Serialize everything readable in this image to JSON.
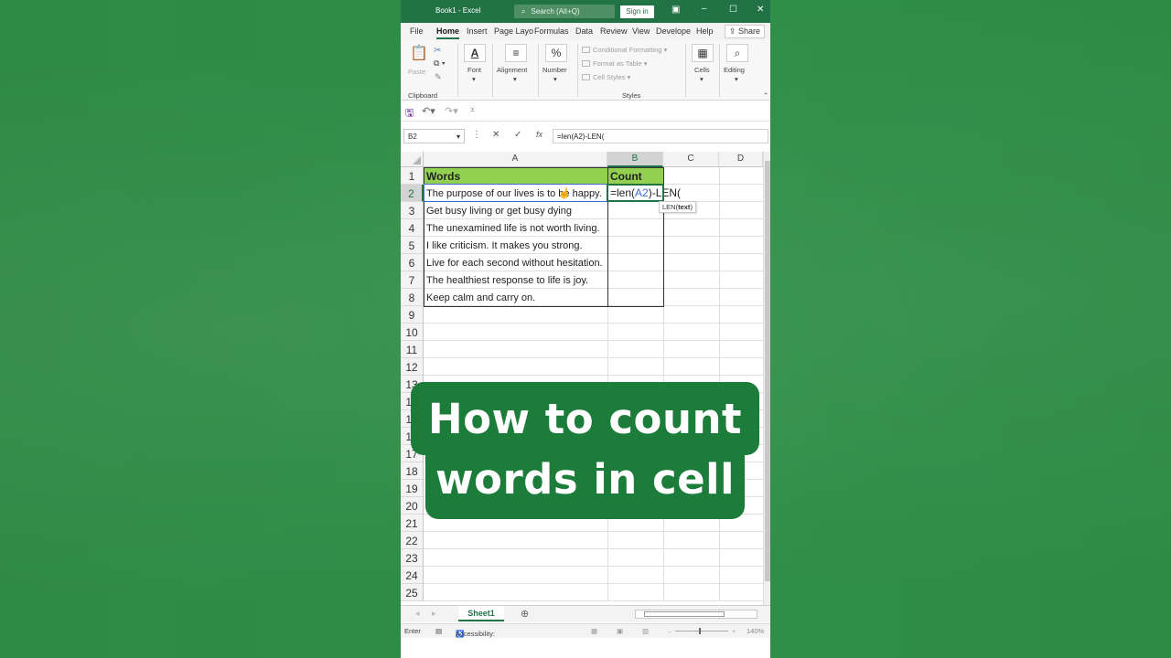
{
  "window": {
    "title": "Book1 - Excel",
    "search": "Search (Alt+Q)",
    "signin": "Sign in"
  },
  "tabs": [
    "File",
    "Home",
    "Insert",
    "Page Layo",
    "Formulas",
    "Data",
    "Review",
    "View",
    "Develope",
    "Help"
  ],
  "share_label": "Share",
  "ribbon": {
    "paste": "Paste",
    "clipboard": "Clipboard",
    "font": "Font",
    "alignment": "Alignment",
    "number": "Number",
    "conditional_formatting": "Conditional Formatting",
    "format_as_table": "Format as Table",
    "cell_styles": "Cell Styles",
    "styles": "Styles",
    "cells": "Cells",
    "editing": "Editing"
  },
  "formula_bar": {
    "name_box": "B2",
    "content": "=len(A2)-LEN("
  },
  "columns": [
    "A",
    "B",
    "C",
    "D"
  ],
  "rows": [
    "1",
    "2",
    "3",
    "4",
    "5",
    "6",
    "7",
    "8",
    "9",
    "10",
    "11",
    "12",
    "13",
    "14",
    "15",
    "16",
    "17",
    "18",
    "19",
    "20",
    "21",
    "22",
    "23",
    "24",
    "25"
  ],
  "table": {
    "header_words": "Words",
    "header_count": "Count",
    "words": [
      "The purpose of our lives is to be happy.",
      "Get busy living or get busy dying",
      "The unexamined life is not worth living.",
      "I like criticism. It makes you strong.",
      "Live for each second without hesitation.",
      "The healthiest response to life is joy.",
      "Keep calm and carry on."
    ]
  },
  "editing_cell": {
    "prefix": "=len(",
    "ref": "A2",
    "suffix": ")-LEN("
  },
  "tooltip": {
    "fn": "LEN(",
    "arg": "text",
    "close": ")"
  },
  "sheet_tab": "Sheet1",
  "status": {
    "mode": "Enter",
    "accessibility": "Accessibility: Good to go",
    "zoom": "140%"
  },
  "overlay": {
    "line1": "How to count",
    "line2": "words in cell"
  },
  "colors": {
    "excel_green": "#217346",
    "header_fill": "#92d050",
    "overlay_green": "#1c7c3a"
  }
}
